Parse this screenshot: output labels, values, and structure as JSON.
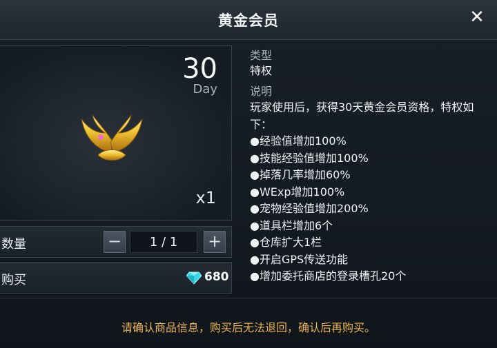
{
  "dialog": {
    "title": "黄金会员",
    "close_symbol": "✕"
  },
  "item": {
    "duration_value": "30",
    "duration_unit": "Day",
    "quantity_badge": "x1",
    "icon": "golden-wings-icon"
  },
  "quantity": {
    "label": "数量",
    "minus": "−",
    "plus": "+",
    "value": "1 / 1"
  },
  "purchase": {
    "label": "购买",
    "currency_icon": "diamond-icon",
    "price": "680"
  },
  "description": {
    "type_heading": "类型",
    "type_value": "特权",
    "desc_heading": "说明",
    "intro": "玩家使用后，获得30天黄金会员资格，特权如下：",
    "benefits": [
      "●经验值增加100%",
      "●技能经验值增加100%",
      "●掉落几率增加60%",
      "●WExp增加100%",
      "●宠物经验值增加200%",
      "●道具栏增加6个",
      "●仓库扩大1栏",
      "●开启GPS传送功能",
      "●增加委托商店的登录槽孔20个"
    ]
  },
  "notice": "请确认商品信息，购买后无法退回，确认后再购买。",
  "colors": {
    "notice": "#e8b454",
    "gem": "#38d8e8",
    "wings": "#e8b52a"
  }
}
